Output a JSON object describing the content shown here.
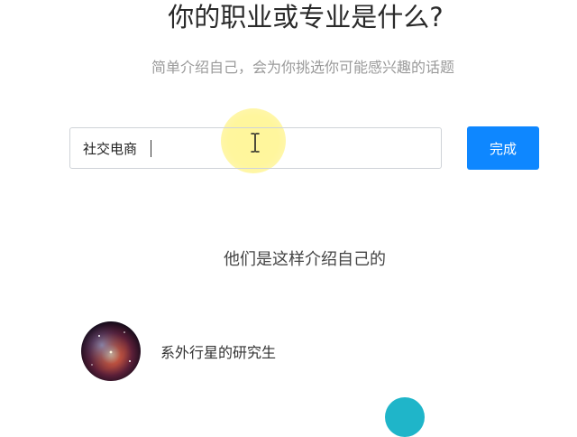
{
  "header": {
    "title": "你的职业或专业是什么?",
    "subtitle": "简单介绍自己，会为你挑选你可能感兴趣的话题"
  },
  "form": {
    "input_value": "社交电商",
    "done_button": "完成"
  },
  "suggestions": {
    "heading": "他们是这样介绍自己的",
    "items": [
      {
        "label": "系外行星的研究生"
      }
    ]
  },
  "colors": {
    "primary_button": "#0e87ff",
    "cursor_highlight": "#fff496",
    "next_avatar": "#1fb5c9"
  },
  "icons": {
    "cursor": "text-cursor-icon"
  }
}
